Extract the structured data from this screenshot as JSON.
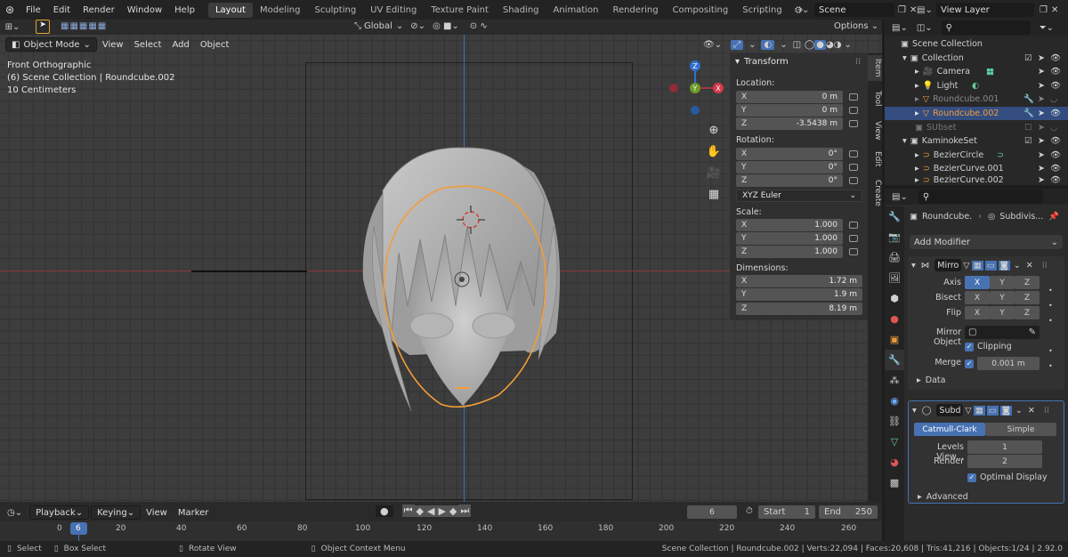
{
  "topbar": {
    "menus": [
      "File",
      "Edit",
      "Render",
      "Window",
      "Help"
    ],
    "workspaces": [
      "Layout",
      "Modeling",
      "Sculpting",
      "UV Editing",
      "Texture Paint",
      "Shading",
      "Animation",
      "Rendering",
      "Compositing",
      "Scripting"
    ],
    "active_workspace": "Layout",
    "scene": "Scene",
    "view_layer": "View Layer"
  },
  "viewport_header": {
    "mode": "Object Mode",
    "menus": [
      "View",
      "Select",
      "Add",
      "Object"
    ],
    "orientation": "Global",
    "options": "Options"
  },
  "overlay": {
    "view_name": "Front Orthographic",
    "collection_info": "(6) Scene Collection | Roundcube.002",
    "scale": "10 Centimeters"
  },
  "gizmo": {
    "z": "Z",
    "y": "Y",
    "x": "X"
  },
  "npanel": {
    "title": "Transform",
    "location_label": "Location:",
    "location": [
      {
        "axis": "X",
        "value": "0 m"
      },
      {
        "axis": "Y",
        "value": "0 m"
      },
      {
        "axis": "Z",
        "value": "-3.5438 m"
      }
    ],
    "rotation_label": "Rotation:",
    "rotation": [
      {
        "axis": "X",
        "value": "0°"
      },
      {
        "axis": "Y",
        "value": "0°"
      },
      {
        "axis": "Z",
        "value": "0°"
      }
    ],
    "rotation_mode": "XYZ Euler",
    "scale_label": "Scale:",
    "scale": [
      {
        "axis": "X",
        "value": "1.000"
      },
      {
        "axis": "Y",
        "value": "1.000"
      },
      {
        "axis": "Z",
        "value": "1.000"
      }
    ],
    "dimensions_label": "Dimensions:",
    "dimensions": [
      {
        "axis": "X",
        "value": "1.72 m"
      },
      {
        "axis": "Y",
        "value": "1.9 m"
      },
      {
        "axis": "Z",
        "value": "8.19 m"
      }
    ],
    "tabs": [
      "Item",
      "Tool",
      "View",
      "Edit",
      "Create"
    ]
  },
  "outliner": {
    "items": [
      {
        "label": "Scene Collection"
      },
      {
        "label": "Collection"
      },
      {
        "label": "Camera"
      },
      {
        "label": "Light"
      },
      {
        "label": "Roundcube.001"
      },
      {
        "label": "Roundcube.002"
      },
      {
        "label": "SUbset"
      },
      {
        "label": "KaminokeSet"
      },
      {
        "label": "BezierCircle"
      },
      {
        "label": "BezierCurve.001"
      },
      {
        "label": "BezierCurve.002"
      }
    ]
  },
  "properties": {
    "object_name": "Roundcube.",
    "modifier_ref": "Subdivis...",
    "add_modifier": "Add Modifier",
    "mirror": {
      "name": "Mirro",
      "axis_label": "Axis",
      "bisect_label": "Bisect",
      "flip_label": "Flip",
      "axes": [
        "X",
        "Y",
        "Z"
      ],
      "mirror_object_label": "Mirror Object",
      "clipping_label": "Clipping",
      "merge_label": "Merge",
      "merge_value": "0.001 m",
      "data_label": "Data"
    },
    "subsurf": {
      "name": "Subd",
      "catmull": "Catmull-Clark",
      "simple": "Simple",
      "levels_label": "Levels View...",
      "levels_value": "1",
      "render_label": "Render",
      "render_value": "2",
      "optimal_label": "Optimal Display",
      "advanced_label": "Advanced"
    }
  },
  "timeline": {
    "menus": [
      "Playback",
      "Keying",
      "View",
      "Marker"
    ],
    "current_frame": "6",
    "start_label": "Start",
    "start": "1",
    "end_label": "End",
    "end": "250",
    "ticks": [
      "0",
      "20",
      "40",
      "60",
      "80",
      "100",
      "120",
      "140",
      "160",
      "180",
      "200",
      "220",
      "240",
      "260"
    ]
  },
  "statusbar": {
    "select": "Select",
    "box_select": "Box Select",
    "rotate_view": "Rotate View",
    "context_menu": "Object Context Menu",
    "stats": "Scene Collection | Roundcube.002 | Verts:22,094 | Faces:20,608 | Tris:41,216 | Objects:1/24 | 2.92.0"
  },
  "colors": {
    "accent": "#4772b3",
    "selected_orange": "#f29d3a",
    "x_axis": "#a8343f",
    "y_axis": "#6b9c24",
    "z_axis": "#2f6fd0"
  }
}
